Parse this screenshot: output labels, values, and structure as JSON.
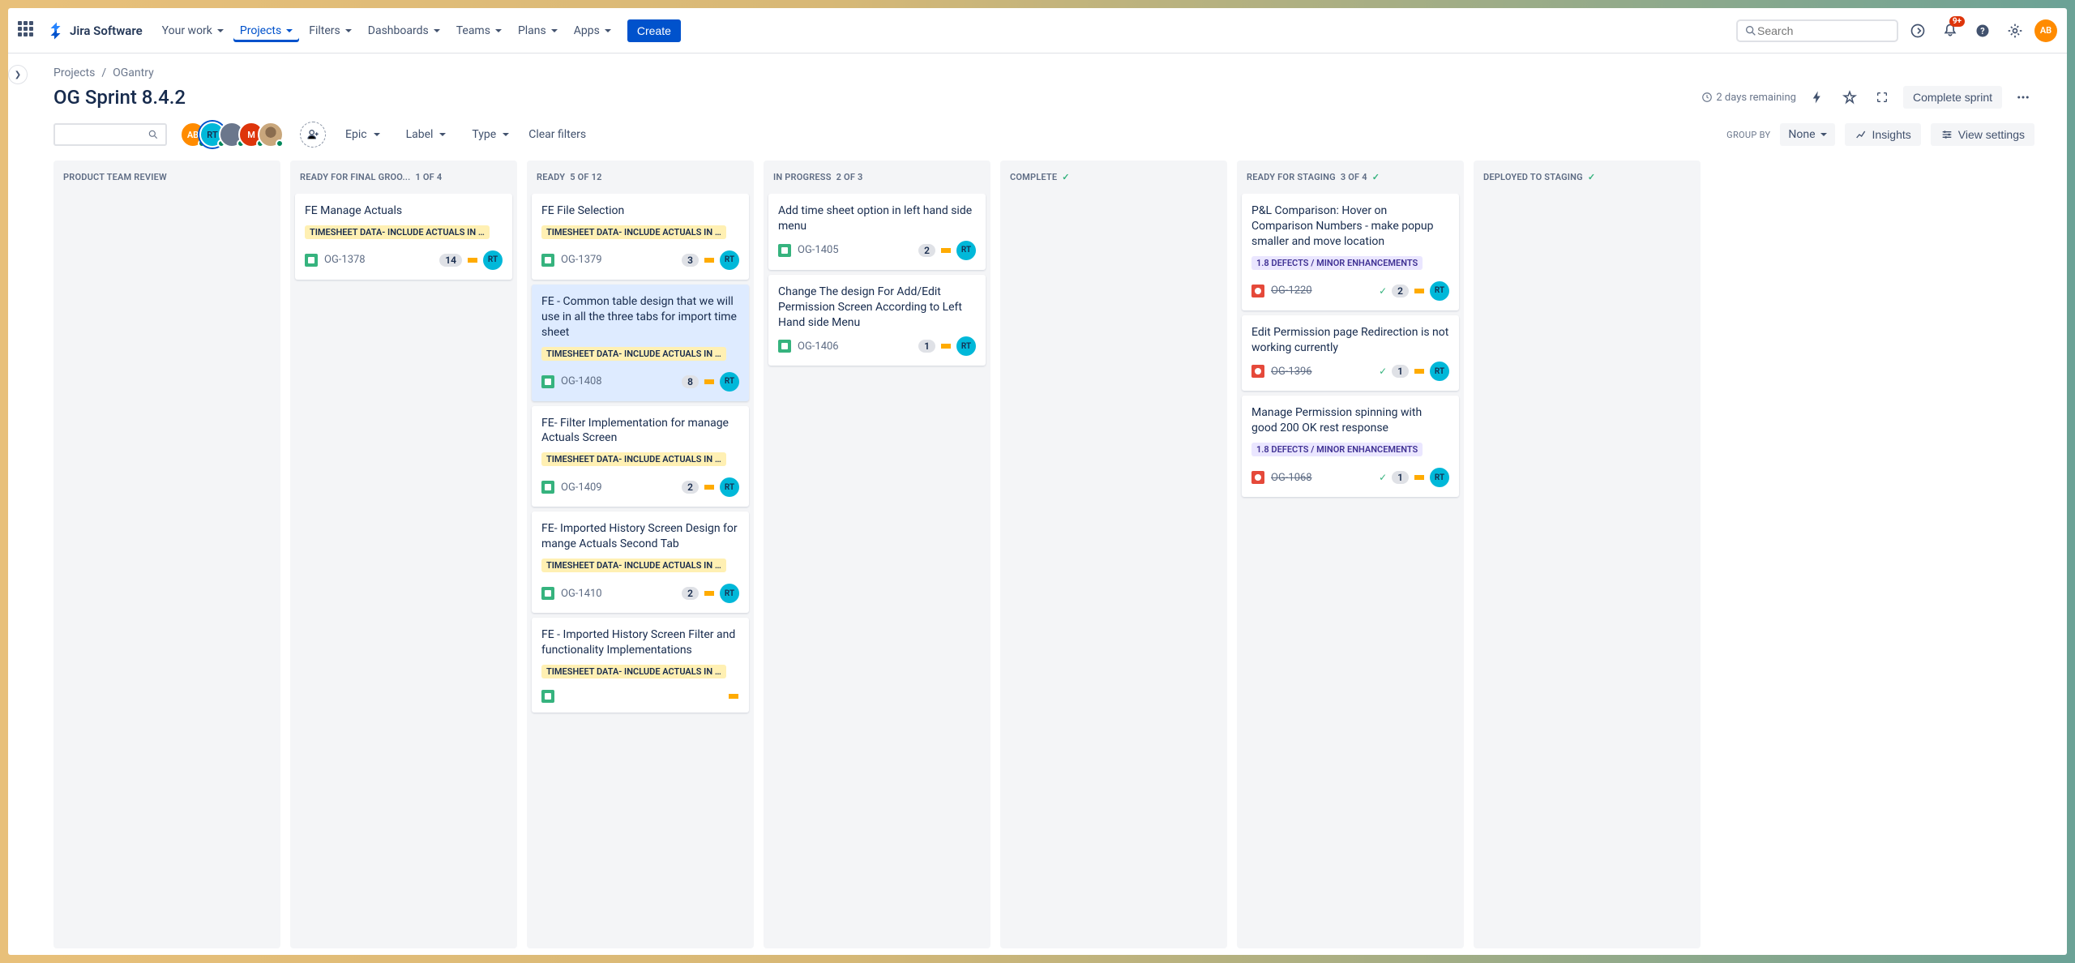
{
  "nav": {
    "logoText": "Jira Software",
    "items": [
      "Your work",
      "Projects",
      "Filters",
      "Dashboards",
      "Teams",
      "Plans",
      "Apps"
    ],
    "activeIndex": 1,
    "createLabel": "Create",
    "searchPlaceholder": "Search",
    "notificationBadge": "9+",
    "userInitials": "AB"
  },
  "breadcrumb": {
    "project": "Projects",
    "name": "OGantry"
  },
  "sprint": {
    "title": "OG Sprint 8.4.2",
    "remaining": "2 days remaining",
    "completeLabel": "Complete sprint"
  },
  "filters": {
    "epic": "Epic",
    "label": "Label",
    "type": "Type",
    "clear": "Clear filters",
    "groupByLabel": "GROUP BY",
    "groupByValue": "None",
    "insights": "Insights",
    "viewSettings": "View settings"
  },
  "avatars": [
    {
      "initials": "AB",
      "cls": "orange"
    },
    {
      "initials": "RT",
      "cls": "teal",
      "selected": true
    },
    {
      "initials": "",
      "cls": "grey"
    },
    {
      "initials": "M",
      "cls": "red"
    },
    {
      "initials": "",
      "cls": "img"
    }
  ],
  "columns": [
    {
      "title": "PRODUCT TEAM REVIEW",
      "count": "",
      "check": false,
      "cards": []
    },
    {
      "title": "READY FOR FINAL GROO...",
      "count": "1 OF 4",
      "check": false,
      "cards": [
        {
          "t": "FE Manage Actuals",
          "epic": "TIMESHEET DATA- INCLUDE ACTUALS IN …",
          "type": "story",
          "key": "OG-1378",
          "pts": "14",
          "pri": "med",
          "asg": "RT",
          "asgCls": "teal"
        }
      ]
    },
    {
      "title": "READY",
      "count": "5 OF 12",
      "check": false,
      "cards": [
        {
          "t": "FE File Selection",
          "epic": "TIMESHEET DATA- INCLUDE ACTUALS IN …",
          "type": "story",
          "key": "OG-1379",
          "pts": "3",
          "pri": "med",
          "asg": "RT",
          "asgCls": "teal"
        },
        {
          "t": "FE - Common table design that we will use in all the three tabs for import time sheet",
          "epic": "TIMESHEET DATA- INCLUDE ACTUALS IN …",
          "type": "story",
          "key": "OG-1408",
          "pts": "8",
          "pri": "med",
          "asg": "RT",
          "asgCls": "teal",
          "sel": true
        },
        {
          "t": "FE- Filter Implementation for manage Actuals Screen",
          "epic": "TIMESHEET DATA- INCLUDE ACTUALS IN …",
          "type": "story",
          "key": "OG-1409",
          "pts": "2",
          "pri": "med",
          "asg": "RT",
          "asgCls": "teal"
        },
        {
          "t": "FE- Imported History Screen Design for mange Actuals Second Tab",
          "epic": "TIMESHEET DATA- INCLUDE ACTUALS IN …",
          "type": "story",
          "key": "OG-1410",
          "pts": "2",
          "pri": "med",
          "asg": "RT",
          "asgCls": "teal"
        },
        {
          "t": "FE - Imported History Screen Filter and functionality Implementations",
          "epic": "TIMESHEET DATA- INCLUDE ACTUALS IN …",
          "type": "story",
          "key": "",
          "pts": "",
          "pri": "med",
          "asg": "",
          "asgCls": ""
        }
      ]
    },
    {
      "title": "IN PROGRESS",
      "count": "2 OF 3",
      "check": false,
      "cards": [
        {
          "t": "Add time sheet option in left hand side menu",
          "type": "story",
          "key": "OG-1405",
          "pts": "2",
          "pri": "med",
          "asg": "RT",
          "asgCls": "teal"
        },
        {
          "t": "Change The design For Add/Edit Permission Screen According to Left Hand side Menu",
          "type": "story",
          "key": "OG-1406",
          "pts": "1",
          "pri": "med",
          "asg": "RT",
          "asgCls": "teal"
        }
      ]
    },
    {
      "title": "COMPLETE",
      "count": "",
      "check": true,
      "cards": []
    },
    {
      "title": "READY FOR STAGING",
      "count": "3 OF 4",
      "check": true,
      "cards": [
        {
          "t": "P&L Comparison: Hover on Comparison Numbers - make popup smaller and move location",
          "epic": "1.8 DEFECTS / MINOR ENHANCEMENTS",
          "epicCls": "purple",
          "type": "bug",
          "key": "OG-1220",
          "done": true,
          "sub": true,
          "pts": "2",
          "pri": "med",
          "asg": "RT",
          "asgCls": "teal"
        },
        {
          "t": "Edit Permission page Redirection is not working currently",
          "type": "bug",
          "key": "OG-1396",
          "done": true,
          "sub": true,
          "pts": "1",
          "pri": "med",
          "asg": "RT",
          "asgCls": "teal"
        },
        {
          "t": "Manage Permission spinning with good 200 OK rest response",
          "epic": "1.8 DEFECTS / MINOR ENHANCEMENTS",
          "epicCls": "purple",
          "type": "bug",
          "key": "OG-1068",
          "done": true,
          "sub": true,
          "pts": "1",
          "pri": "med",
          "asg": "RT",
          "asgCls": "teal"
        }
      ]
    },
    {
      "title": "DEPLOYED TO STAGING",
      "count": "",
      "check": true,
      "cards": []
    }
  ]
}
